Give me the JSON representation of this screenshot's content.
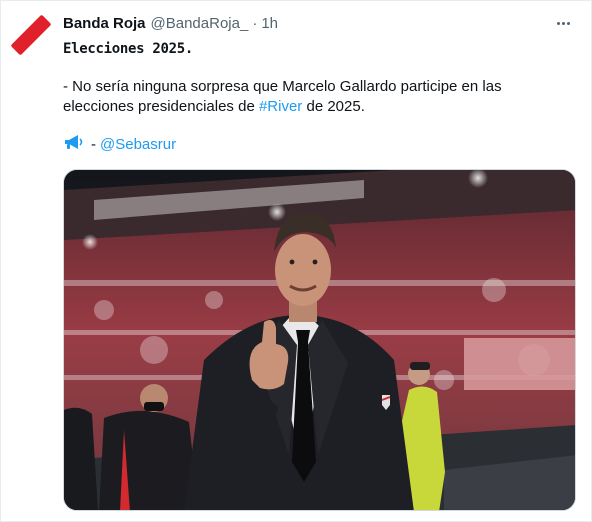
{
  "tweet": {
    "author_name": "Banda Roja",
    "author_handle": "@BandaRoja_",
    "separator": "·",
    "time": "1h",
    "avatar_icon": "red-stripe-logo-icon",
    "more_icon": "ellipsis-icon",
    "title": "Elecciones 2025.",
    "text_before_hashtag": "- No sería ninguna sorpresa que Marcelo Gallardo participe en las elecciones presidenciales de ",
    "hashtag": "#River",
    "text_after_hashtag": " de 2025.",
    "credit_icon": "megaphone-icon",
    "credit_separator": "-",
    "credit_mention": "@Sebasrur",
    "media_description_icon": "photo-man-thumbs-up-stadium"
  },
  "colors": {
    "brand_red": "#e0202a",
    "link_blue": "#1d9bf0",
    "muted": "#536471"
  }
}
